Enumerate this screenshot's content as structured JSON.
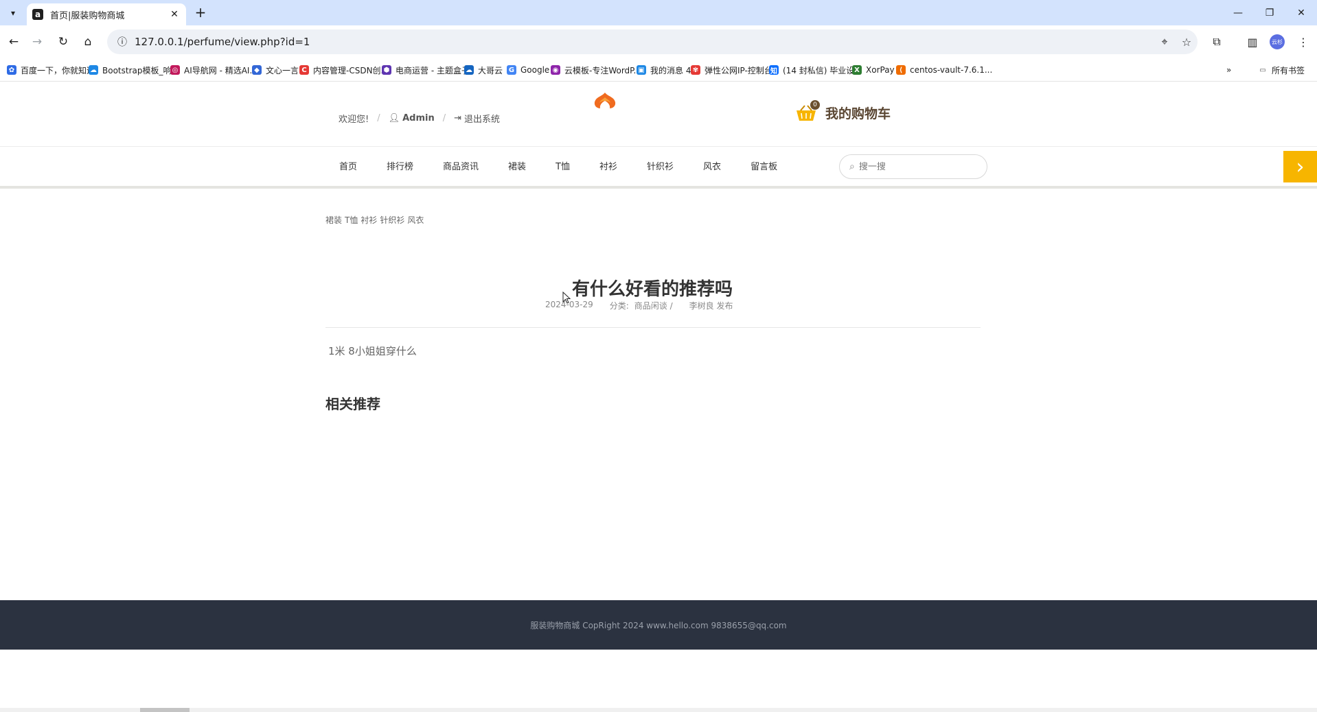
{
  "browser": {
    "tab_title": "首页|服装购物商城",
    "tab_favicon": "a",
    "url": "127.0.0.1/perfume/view.php?id=1",
    "profile_label": "云杉",
    "bookmarks": [
      {
        "label": "百度一下，你就知道",
        "icon": "paw-icon",
        "color": "#2e6be5"
      },
      {
        "label": "Bootstrap模板_响...",
        "icon": "cloud-icon",
        "color": "#1e88e5"
      },
      {
        "label": "AI导航网 - 精选AI...",
        "icon": "spiral-icon",
        "color": "#c2185b"
      },
      {
        "label": "文心一言",
        "icon": "cube-icon",
        "color": "#3367d6"
      },
      {
        "label": "内容管理-CSDN创...",
        "icon": "csdn-icon",
        "color": "#e53935"
      },
      {
        "label": "电商运营 - 主题盒子",
        "icon": "hexagon-icon",
        "color": "#5e35b1"
      },
      {
        "label": "大哥云",
        "icon": "cloud-badge-icon",
        "color": "#1565c0"
      },
      {
        "label": "Google",
        "icon": "google-icon",
        "color": "#4285f4"
      },
      {
        "label": "云模板-专注WordP...",
        "icon": "swirl-icon",
        "color": "#8e24aa"
      },
      {
        "label": "我的消息 4",
        "icon": "bilibili-icon",
        "color": "#1e88e5"
      },
      {
        "label": "弹性公网IP-控制台",
        "icon": "huawei-icon",
        "color": "#e53935"
      },
      {
        "label": "(14 封私信) 毕业设...",
        "icon": "zhihu-icon",
        "color": "#0d6efd"
      },
      {
        "label": "XorPay",
        "icon": "x-icon",
        "color": "#2e7d32"
      },
      {
        "label": "centos-vault-7.6.1...",
        "icon": "bracket-icon",
        "color": "#ef6c00"
      }
    ],
    "all_bookmarks": "所有书签"
  },
  "header": {
    "welcome": "欢迎您!",
    "user": "Admin",
    "logout": "退出系统",
    "cart_label": "我的购物车",
    "cart_count": "0"
  },
  "nav": {
    "items": [
      "首页",
      "排行榜",
      "商品资讯",
      "裙装",
      "T恤",
      "衬衫",
      "针织衫",
      "风衣",
      "留言板"
    ],
    "search_placeholder": "搜一搜"
  },
  "tags": [
    "裙装",
    "T恤",
    "衬衫",
    "针织衫",
    "风衣"
  ],
  "article": {
    "title": "有什么好看的推荐吗",
    "date": "2024-03-29",
    "category_label": "分类:",
    "category": "商品闲谈 /",
    "author": "李树良 发布",
    "body": "1米 8小姐姐穿什么",
    "related_heading": "相关推荐"
  },
  "footer": {
    "text": "服装购物商城 CopRight 2024 www.hello.com 9838655@qq.com"
  },
  "colors": {
    "accent": "#f7b500",
    "footer_bg": "#2b3240",
    "logo": "#f06b1f",
    "cart_text": "#5a4632"
  }
}
